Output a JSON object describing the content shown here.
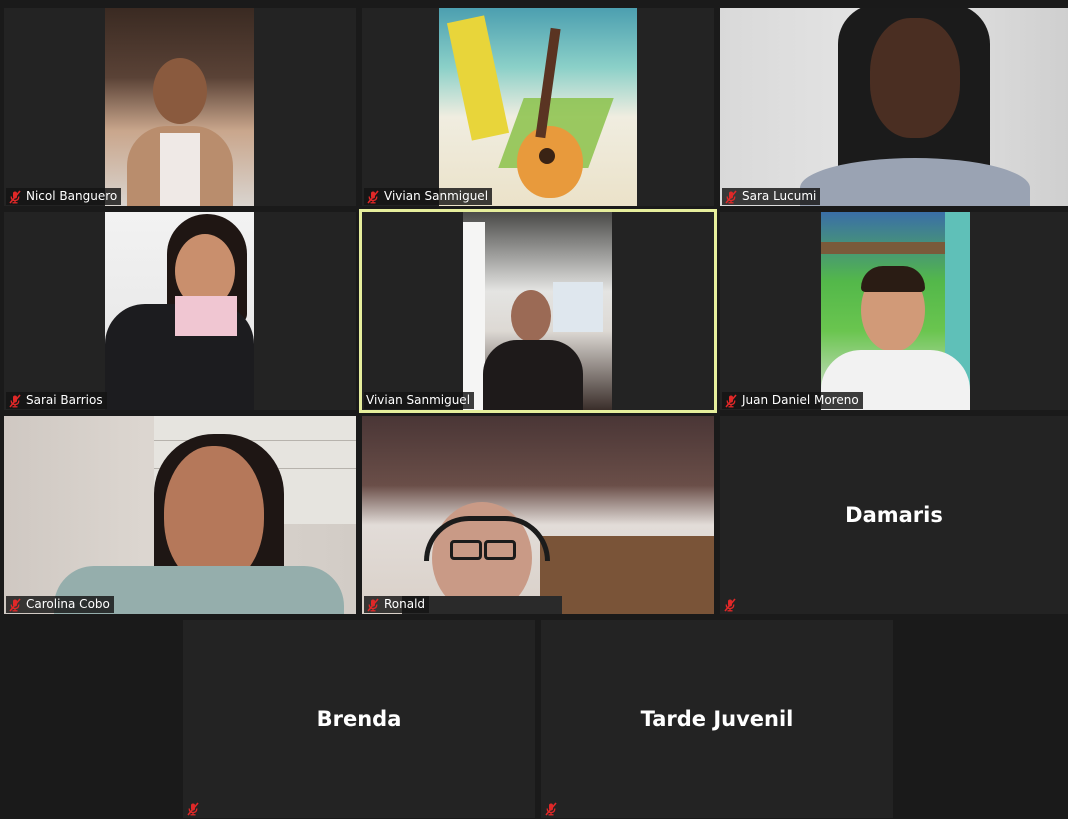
{
  "participants": [
    {
      "name": "Nicol  Banguero",
      "muted": true
    },
    {
      "name": "Vivian Sanmiguel",
      "muted": true
    },
    {
      "name": "Sara Lucumi",
      "muted": true
    },
    {
      "name": "Sarai Barrios",
      "muted": true
    },
    {
      "name": "Vivian Sanmiguel",
      "muted": false,
      "active_speaker": true
    },
    {
      "name": "Juan Daniel Moreno",
      "muted": true
    },
    {
      "name": "Carolina Cobo",
      "muted": true
    },
    {
      "name": "Ronald",
      "muted": true
    },
    {
      "name": "Damaris",
      "muted": true,
      "video_off": true,
      "display_name": "Damaris"
    },
    {
      "name": "Brenda",
      "muted": true,
      "video_off": true,
      "display_name": "Brenda"
    },
    {
      "name": "Tarde Juvenil",
      "muted": true,
      "video_off": true,
      "display_name": "Tarde Juvenil"
    }
  ],
  "colors": {
    "active_border": "#e6ee9c",
    "mute_icon": "#e02828",
    "tile_bg": "#232323",
    "page_bg": "#1a1a1a"
  }
}
